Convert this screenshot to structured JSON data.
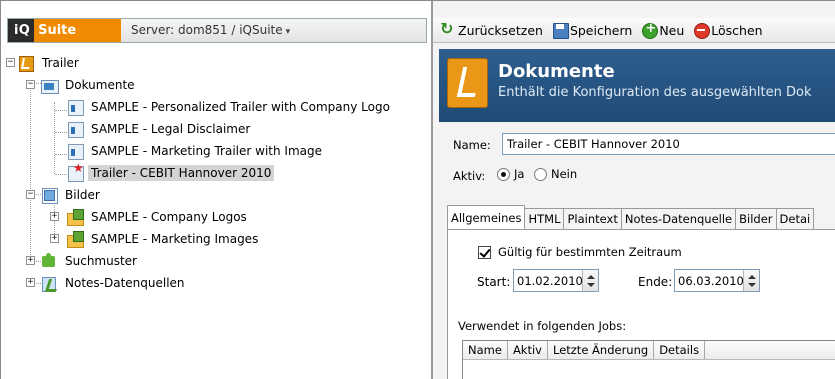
{
  "app": {
    "logo_iq": "iQ",
    "logo_suite": "Suite",
    "server": "Server: dom851 / iQSuite",
    "server_arrow": "▾"
  },
  "tree": {
    "root": "Trailer",
    "dokumente": {
      "label": "Dokumente",
      "items": [
        "SAMPLE - Personalized Trailer with Company Logo",
        "SAMPLE - Legal Disclaimer",
        "SAMPLE - Marketing Trailer with Image",
        "Trailer - CEBIT Hannover 2010"
      ]
    },
    "bilder": {
      "label": "Bilder",
      "items": [
        "SAMPLE - Company Logos",
        "SAMPLE - Marketing Images"
      ]
    },
    "suchmuster": "Suchmuster",
    "notes": "Notes-Datenquellen"
  },
  "toolbar": {
    "reset": "Zurücksetzen",
    "save": "Speichern",
    "new": "Neu",
    "delete": "Löschen"
  },
  "header": {
    "title": "Dokumente",
    "subtitle": "Enthält die Konfiguration des ausgewählten Dok"
  },
  "form": {
    "name_label": "Name:",
    "name_value": "Trailer - CEBIT Hannover 2010",
    "aktiv_label": "Aktiv:",
    "ja": "Ja",
    "nein": "Nein",
    "tabs": [
      "Allgemeines",
      "HTML",
      "Plaintext",
      "Notes-Datenquelle",
      "Bilder",
      "Detai"
    ],
    "period_label": "Gültig für bestimmten Zeitraum",
    "start_label": "Start:",
    "start_value": "01.02.2010",
    "ende_label": "Ende:",
    "ende_value": "06.03.2010",
    "jobs_label": "Verwendet in folgenden Jobs:",
    "jobs_columns": [
      "Name",
      "Aktiv",
      "Letzte Änderung",
      "Details"
    ]
  },
  "colors": {
    "accent": "#f08a00",
    "header_bg": "#2b5a88",
    "selection": "#d4d4d4"
  }
}
